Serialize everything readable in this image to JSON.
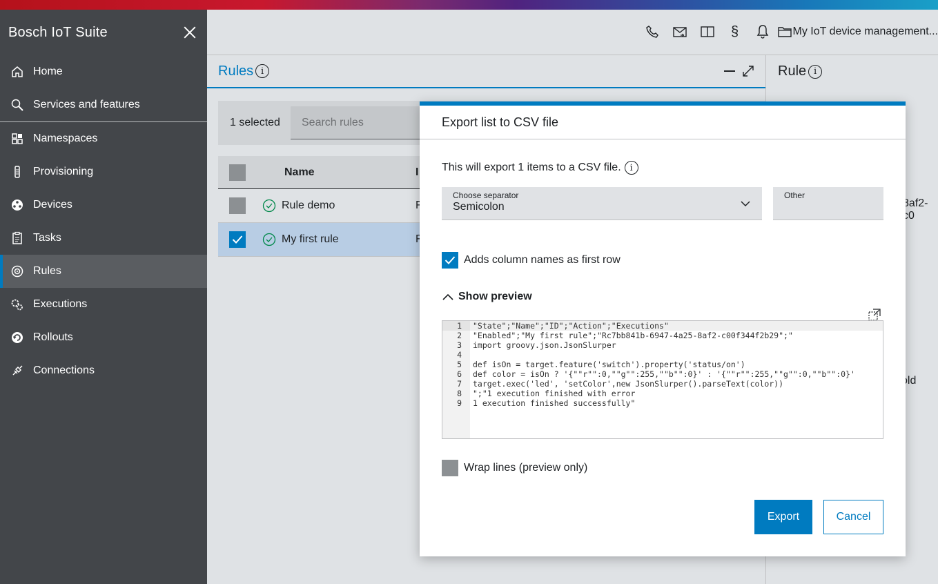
{
  "app": {
    "title": "Bosch IoT Suite"
  },
  "sidebar": {
    "items": [
      {
        "label": "Home",
        "icon": "home-icon"
      },
      {
        "label": "Services and features",
        "icon": "search-icon"
      },
      {
        "label": "Namespaces",
        "icon": "namespaces-icon"
      },
      {
        "label": "Provisioning",
        "icon": "provisioning-icon"
      },
      {
        "label": "Devices",
        "icon": "devices-icon"
      },
      {
        "label": "Tasks",
        "icon": "tasks-icon"
      },
      {
        "label": "Rules",
        "icon": "rules-icon",
        "active": true
      },
      {
        "label": "Executions",
        "icon": "executions-icon"
      },
      {
        "label": "Rollouts",
        "icon": "rollouts-icon"
      },
      {
        "label": "Connections",
        "icon": "connections-icon"
      }
    ]
  },
  "header": {
    "subscription": "My IoT device management..."
  },
  "rules": {
    "title": "Rules",
    "selected": "1 selected",
    "search_placeholder": "Search rules",
    "col_name": "Name",
    "col_i": "I",
    "rows": [
      {
        "name": "Rule demo",
        "col2": "F",
        "checked": false
      },
      {
        "name": "My first rule",
        "col2": "F",
        "checked": true
      }
    ]
  },
  "rule_detail": {
    "title": "Rule",
    "frag1": "8af2-c0",
    "frag2": "old"
  },
  "dialog": {
    "title": "Export list to CSV file",
    "description": "This will export 1 items to a CSV file.",
    "separator_label": "Choose separator",
    "separator_value": "Semicolon",
    "other_label": "Other",
    "column_names_label": "Adds column names as first row",
    "show_preview": "Show preview",
    "wrap_label": "Wrap lines (preview only)",
    "export_label": "Export",
    "cancel_label": "Cancel",
    "preview_lines": [
      "\"State\";\"Name\";\"ID\";\"Action\";\"Executions\"",
      "\"Enabled\";\"My first rule\";\"Rc7bb841b-6947-4a25-8af2-c00f344f2b29\";\"",
      "import groovy.json.JsonSlurper",
      "",
      "def isOn = target.feature('switch').property('status/on')",
      "def color = isOn ? '{\"\"r\"\":0,\"\"g\"\":255,\"\"b\"\":0}' : '{\"\"r\"\":255,\"\"g\"\":0,\"\"b\"\":0}'",
      "target.exec('led', 'setColor',new JsonSlurper().parseText(color))",
      "\";\"1 execution finished with error",
      "1 execution finished successfully\""
    ]
  },
  "colors": {
    "accent": "#007bc0",
    "sidebar_bg": "#43464a"
  }
}
